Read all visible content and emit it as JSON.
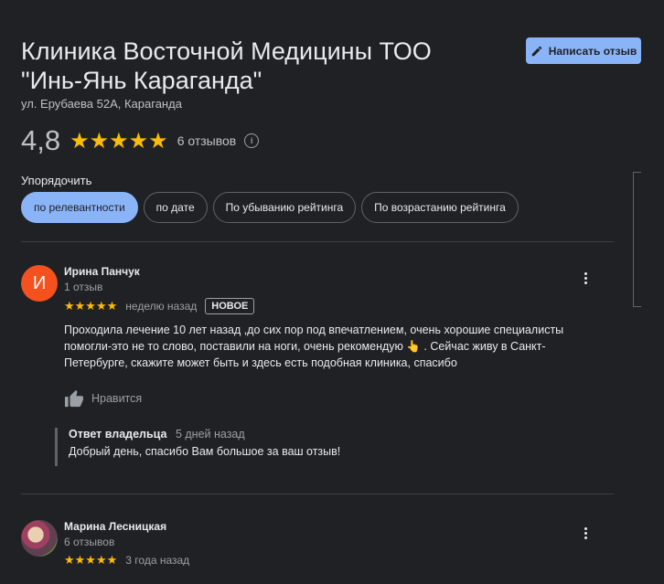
{
  "place": {
    "title_line1": "Клиника Восточной Медицины ТОО",
    "title_line2": "\"Инь-Янь Караганда\"",
    "address": "ул. Ерубаева 52А, Караганда",
    "rating": "4,8",
    "stars": "★★★★★",
    "reviews_count": "6 отзывов",
    "info_icon": "i"
  },
  "write_button": {
    "label": "Написать отзыв",
    "icon": "pencil-icon"
  },
  "sort": {
    "label": "Упорядочить",
    "options": [
      "по релевантности",
      "по дате",
      "По убыванию рейтинга",
      "По возрастанию рейтинга"
    ],
    "selected": "по релевантности"
  },
  "reviews": [
    {
      "avatar_letter": "И",
      "name": "Ирина Панчук",
      "meta": "1 отзыв",
      "stars": "★★★★★",
      "when": "неделю назад",
      "badge": "НОВОЕ",
      "text": "Проходила лечение 10 лет назад ,до сих пор под впечатлением, очень хорошие специалисты помогли-это не то слово, поставили на ноги, очень рекомендую 👆 . Сейчас живу в Санкт-Петербурге, скажите может быть и здесь есть подобная клиника, спасибо",
      "like_label": "Нравится",
      "owner_reply": {
        "label": "Ответ владельца",
        "when": "5 дней назад",
        "text": "Добрый день, спасибо Вам большое за ваш отзыв!"
      }
    },
    {
      "name": "Марина Лесницкая",
      "meta": "6 отзывов",
      "stars": "★★★★★",
      "when": "3 года назад"
    }
  ],
  "colors": {
    "accent": "#8ab4f8",
    "star": "#fbbc04",
    "avatar_orange": "#f4511e",
    "background": "#202124"
  }
}
